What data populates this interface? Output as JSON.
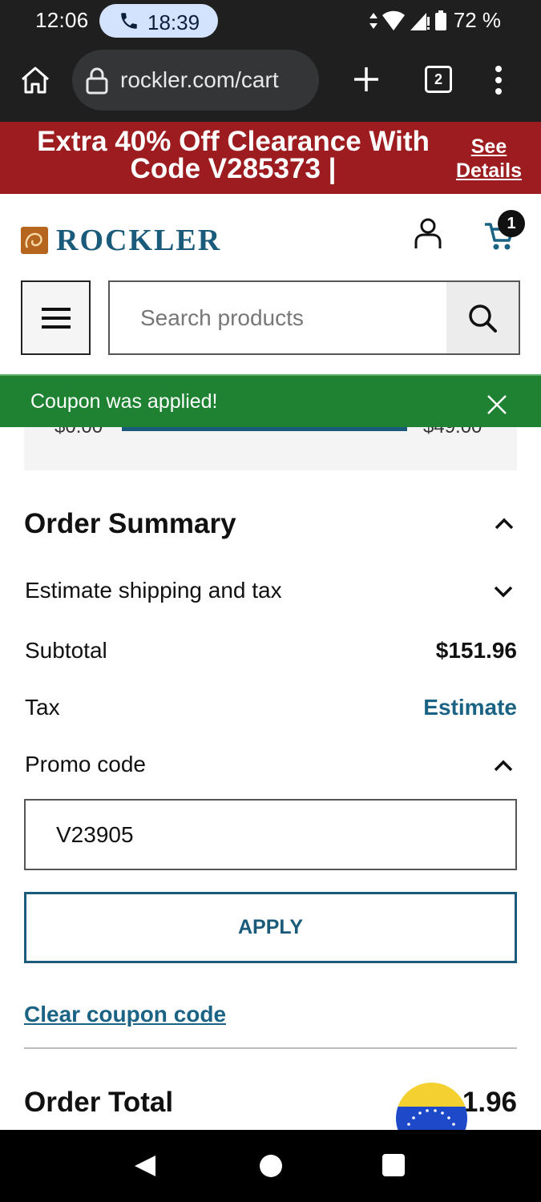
{
  "status_bar": {
    "time": "12:06",
    "call_timer": "18:39",
    "battery": "72 %",
    "icons": [
      "phone-icon",
      "data-arrows-icon",
      "wifi-icon",
      "cell-signal-icon",
      "battery-icon"
    ]
  },
  "browser": {
    "url": "rockler.com/cart",
    "tab_count": "2",
    "icons": [
      "home-icon",
      "lock-icon",
      "plus-icon",
      "tabs-icon",
      "more-vert-icon"
    ]
  },
  "promo_banner": {
    "text": "Extra 40% Off Clearance With Code V285373 |",
    "link": "See Details",
    "color": "#9c1c1f"
  },
  "header": {
    "logo": "ROCKLER",
    "cart_count": "1",
    "search_placeholder": "Search products",
    "icons": [
      "account-icon",
      "cart-icon",
      "menu-icon",
      "search-icon"
    ]
  },
  "toast": {
    "message": "Coupon was applied!",
    "color": "#1e8232"
  },
  "progress": {
    "min_label": "$0.00",
    "max_label": "$49.00"
  },
  "order_summary": {
    "title": "Order Summary",
    "estimate_label": "Estimate shipping and tax",
    "subtotal_label": "Subtotal",
    "subtotal_value": "$151.96",
    "tax_label": "Tax",
    "tax_link": "Estimate",
    "promo_label": "Promo code",
    "promo_value": "V23905",
    "apply_label": "APPLY",
    "clear_label": "Clear coupon code",
    "total_label": "Order Total",
    "total_value_visible": "1.96",
    "accent_color": "#1a5a7a"
  }
}
